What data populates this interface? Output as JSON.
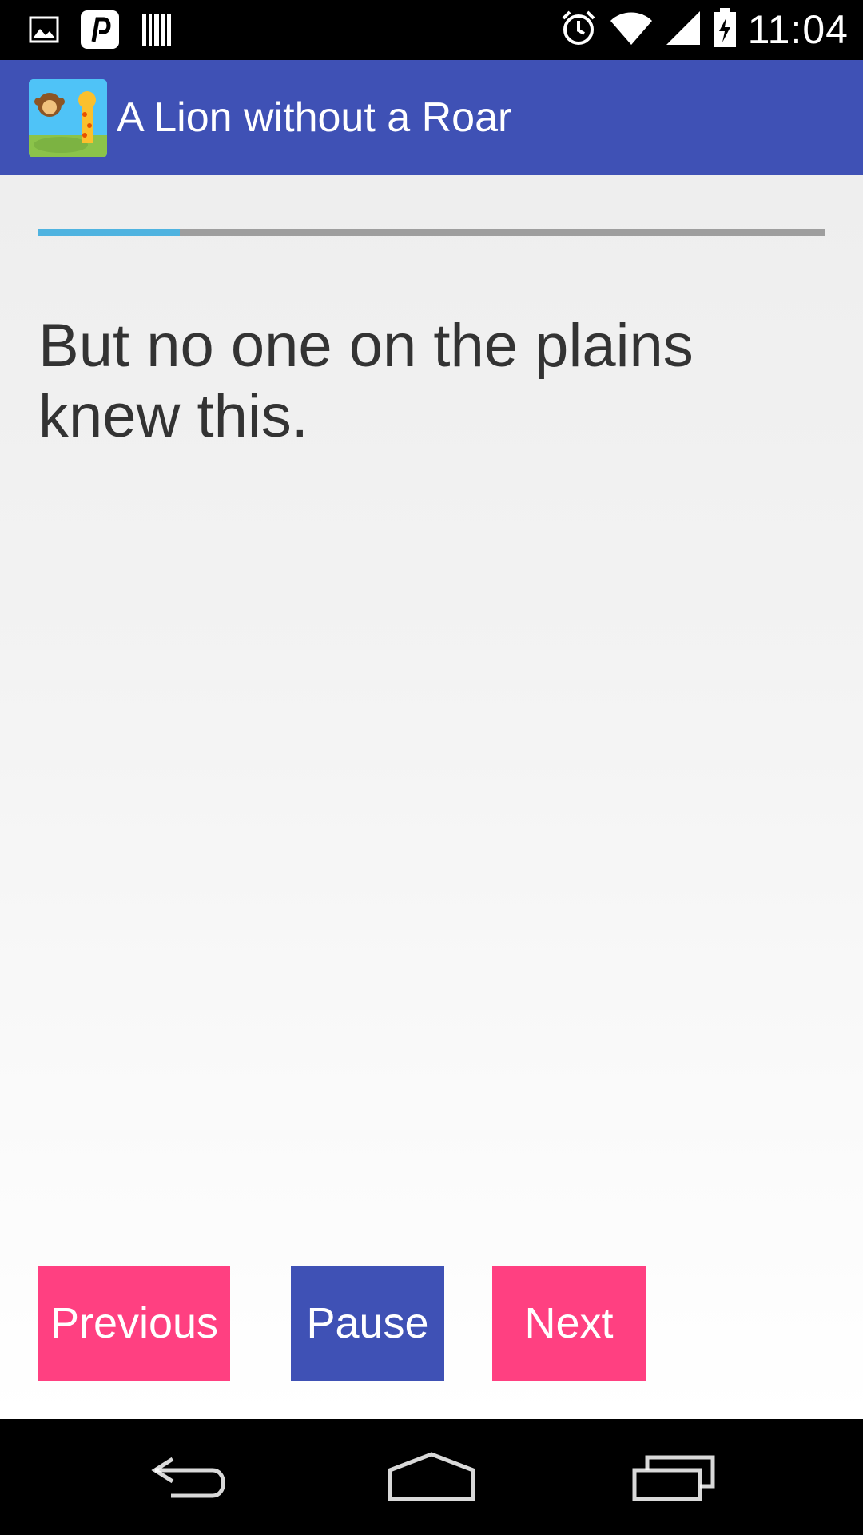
{
  "status_bar": {
    "time": "11:04",
    "left_icons": [
      "image-icon",
      "pinterest-icon",
      "barcode-icon"
    ],
    "right_icons": [
      "alarm-icon",
      "wifi-icon",
      "signal-icon",
      "battery-charging-icon"
    ]
  },
  "app_bar": {
    "title": "A Lion without a Roar",
    "icon": "app-animals-icon"
  },
  "progress": {
    "value": 0.18
  },
  "story": {
    "text": "But no one on the plains knew this."
  },
  "controls": {
    "previous_label": "Previous",
    "pause_label": "Pause",
    "next_label": "Next"
  },
  "colors": {
    "primary": "#3f51b5",
    "accent": "#ff4081",
    "progress": "#4fb3e0"
  },
  "nav_bar": {
    "icons": [
      "back-icon",
      "home-icon",
      "recents-icon"
    ]
  }
}
